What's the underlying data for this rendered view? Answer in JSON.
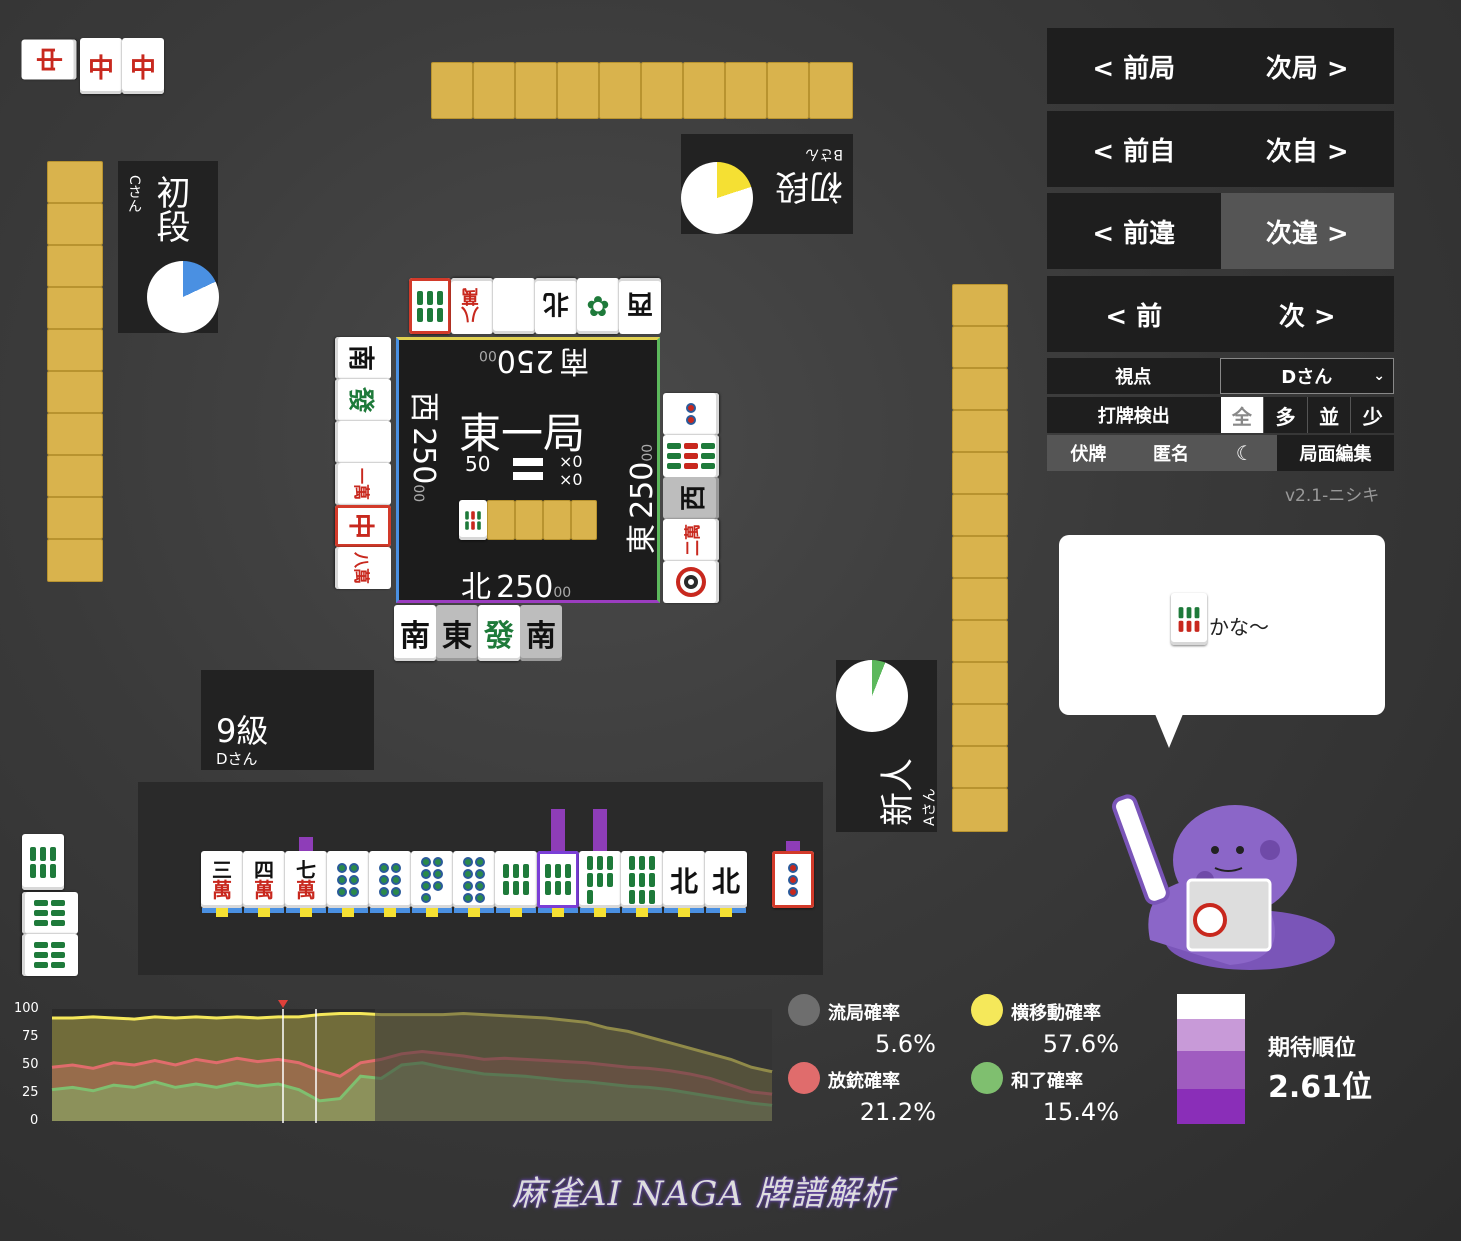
{
  "nav": {
    "prev_round": "< 前局",
    "next_round": "次局 >",
    "prev_self": "< 前自",
    "next_self": "次自 >",
    "prev_diff": "< 前違",
    "next_diff": "次違 >",
    "prev": "< 前",
    "next": "次 >"
  },
  "settings": {
    "viewpoint_label": "視点",
    "viewpoint_value": "Dさん",
    "detect_label": "打牌検出",
    "detect_options": [
      "全",
      "多",
      "並",
      "少"
    ],
    "fukuhai": "伏牌",
    "tokumei": "匿名",
    "moon_icon": "moon-icon",
    "edit": "局面編集",
    "version": "v2.1-ニシキ"
  },
  "center": {
    "round": "東一局",
    "honba": "50",
    "sticks_1": "×0",
    "sticks_2": "×0",
    "south": {
      "wind": "南",
      "score": "250",
      "small": "00"
    },
    "west": {
      "wind": "西",
      "score": "250",
      "small": "00"
    },
    "east": {
      "wind": "東",
      "score": "250",
      "small": "00"
    },
    "north": {
      "wind": "北",
      "score": "250",
      "small": "00"
    }
  },
  "players": {
    "top": {
      "rank": "初段",
      "name": "Bさん"
    },
    "left": {
      "rank": "初段",
      "name": "Cさん"
    },
    "bottom": {
      "rank": "9級",
      "name": "Dさん"
    },
    "right": {
      "rank": "新人",
      "name": "Aさん"
    }
  },
  "hand": {
    "tiles": [
      "三萬",
      "四萬",
      "七萬",
      "6p",
      "6p",
      "7p",
      "8p",
      "6s",
      "6s",
      "7s",
      "9s",
      "北",
      "北"
    ],
    "drawn": "3p"
  },
  "discards": {
    "top": [
      "6s",
      "八萬",
      "白",
      "北",
      "1s",
      "西"
    ],
    "left": [
      "南",
      "發",
      "白",
      "一萬",
      "中",
      "八萬"
    ],
    "right": [
      "2p",
      "9s",
      "西",
      "二萬",
      "1p"
    ],
    "bottom": [
      "南",
      "東",
      "發",
      "南"
    ],
    "dora": "6s"
  },
  "melds": {
    "topleft": [
      "中",
      "中",
      "中"
    ]
  },
  "bubble": {
    "text": "かな〜",
    "tile": "6s"
  },
  "stats": {
    "ryukyoku_label": "流局確率",
    "ryukyoku": "5.6%",
    "yokoido_label": "横移動確率",
    "yokoido": "57.6%",
    "houju_label": "放銃確率",
    "houju": "21.2%",
    "agari_label": "和了確率",
    "agari": "15.4%",
    "rank_label": "期待順位",
    "rank": "2.61位",
    "colors": {
      "ryukyoku": "#6e6e6e",
      "yokoido": "#f5e85a",
      "houju": "#e06c6c",
      "agari": "#7fbf6f"
    }
  },
  "chart_data": {
    "type": "area",
    "yticks": [
      "100",
      "75",
      "50",
      "25",
      "0"
    ],
    "ylim": [
      0,
      100
    ],
    "series": [
      {
        "values": [
          92,
          92,
          93,
          92,
          91,
          93,
          92,
          93,
          92,
          93,
          92,
          93,
          93,
          95,
          96,
          96,
          95,
          95,
          95,
          95,
          96,
          95,
          94,
          93,
          92,
          90,
          88,
          83,
          80,
          75,
          70,
          65,
          60,
          55,
          48,
          44
        ]
      },
      {
        "values": [
          48,
          50,
          47,
          52,
          50,
          54,
          50,
          55,
          52,
          56,
          53,
          55,
          52,
          45,
          40,
          52,
          55,
          60,
          62,
          60,
          58,
          55,
          56,
          55,
          54,
          53,
          52,
          50,
          48,
          47,
          45,
          42,
          38,
          32,
          26,
          24
        ]
      },
      {
        "values": [
          28,
          30,
          27,
          32,
          30,
          35,
          30,
          33,
          30,
          34,
          31,
          33,
          28,
          18,
          20,
          40,
          38,
          50,
          52,
          48,
          45,
          42,
          41,
          40,
          38,
          36,
          35,
          33,
          31,
          30,
          28,
          25,
          22,
          19,
          16,
          14
        ]
      }
    ]
  },
  "logo": "麻雀AI NAGA 牌譜解析"
}
